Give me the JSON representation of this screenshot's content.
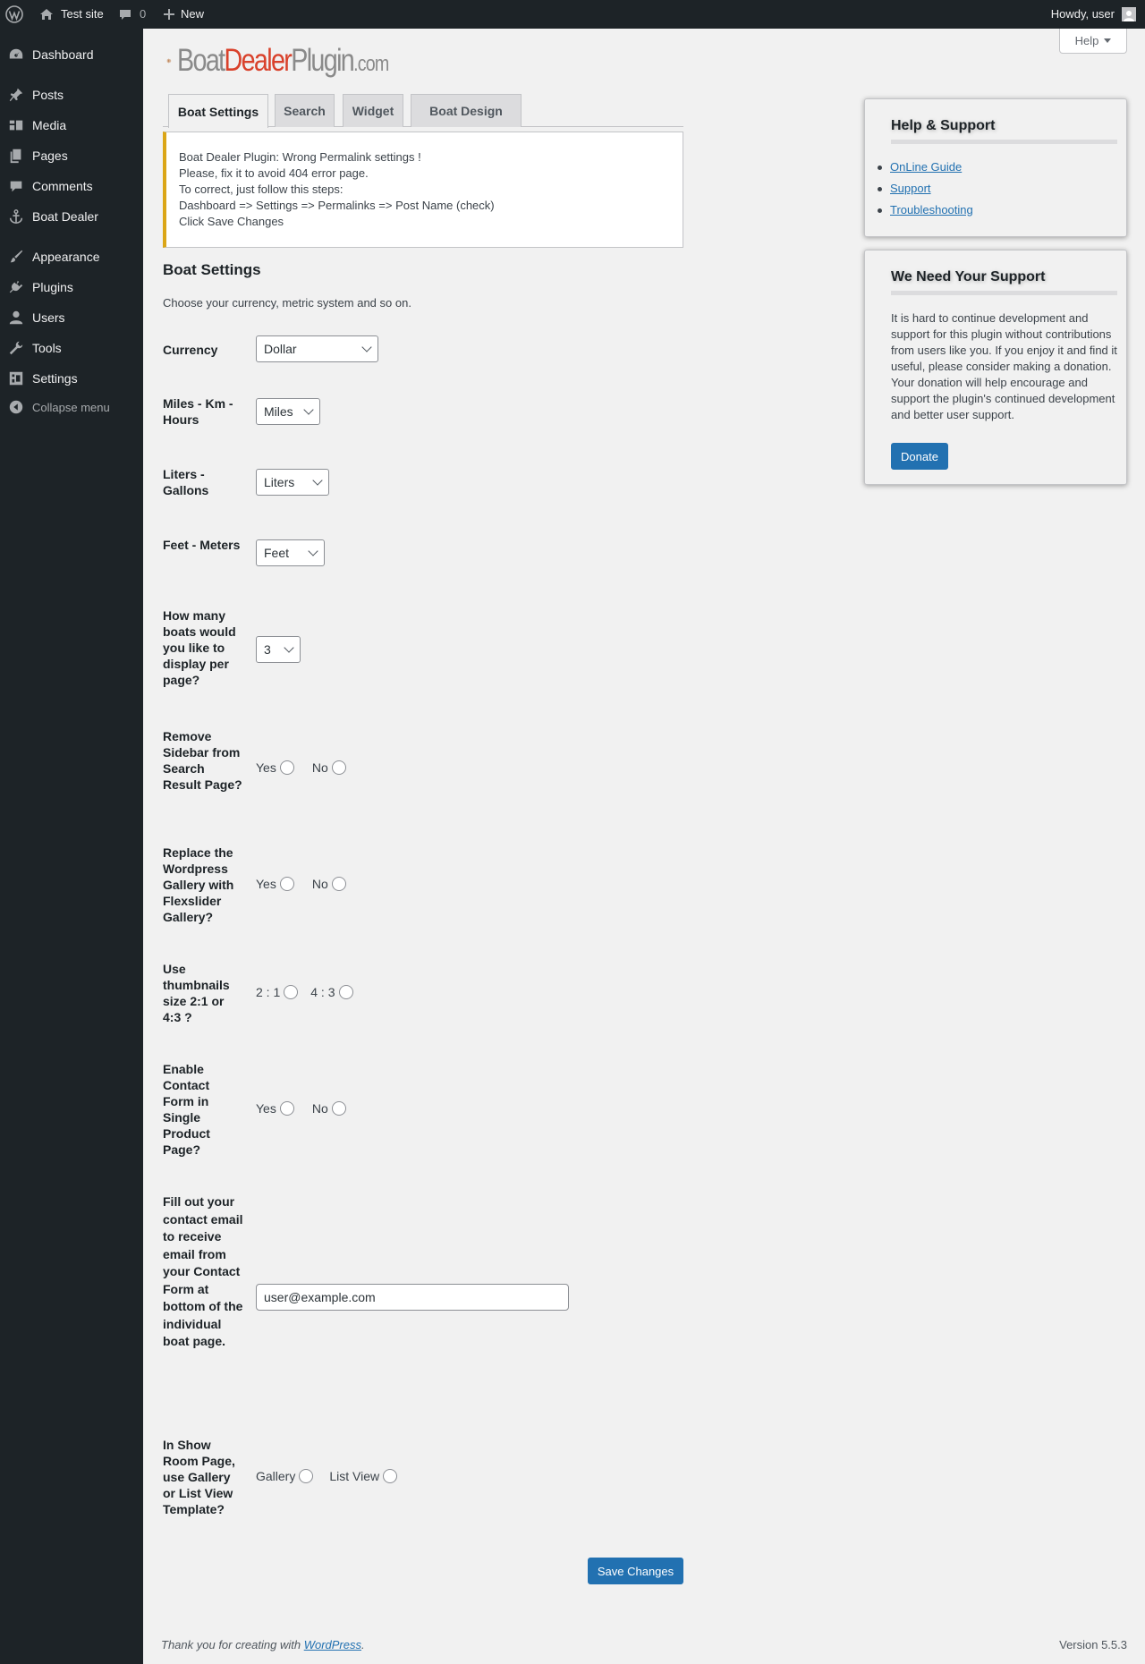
{
  "adminbar": {
    "site_name": "Test site",
    "comments_count": "0",
    "new_label": "New",
    "howdy": "Howdy, user"
  },
  "sidebar": {
    "items": [
      {
        "label": "Dashboard",
        "icon": "dashboard-icon"
      },
      {
        "label": "Posts",
        "icon": "pin-icon"
      },
      {
        "label": "Media",
        "icon": "media-icon"
      },
      {
        "label": "Pages",
        "icon": "pages-icon"
      },
      {
        "label": "Comments",
        "icon": "comment-icon"
      },
      {
        "label": "Boat Dealer",
        "icon": "anchor-icon"
      },
      {
        "label": "Appearance",
        "icon": "brush-icon"
      },
      {
        "label": "Plugins",
        "icon": "plugin-icon"
      },
      {
        "label": "Users",
        "icon": "user-icon"
      },
      {
        "label": "Tools",
        "icon": "wrench-icon"
      },
      {
        "label": "Settings",
        "icon": "settings-icon"
      }
    ],
    "collapse_label": "Collapse menu"
  },
  "help_tab": {
    "label": "Help"
  },
  "logo": {
    "part1": "Boat",
    "part2": "Dealer",
    "part3": "Plugin",
    "part4": ".com"
  },
  "tabs": [
    {
      "label": "Boat Settings",
      "active": true
    },
    {
      "label": "Search"
    },
    {
      "label": "Widget"
    },
    {
      "label": "Boat Design"
    }
  ],
  "notice": {
    "lines": [
      "Boat Dealer Plugin: Wrong Permalink settings !",
      "Please, fix it to avoid 404 error page.",
      "To correct, just follow this steps:",
      "Dashboard => Settings => Permalinks => Post Name (check)",
      "Click Save Changes"
    ],
    "accent_color": "#dba617"
  },
  "settings": {
    "title": "Boat Settings",
    "description": "Choose your currency, metric system and so on.",
    "currency": {
      "label": "Currency",
      "value": "Dollar"
    },
    "distance": {
      "label": "Miles - Km - Hours",
      "value": "Miles"
    },
    "volume": {
      "label": "Liters - Gallons",
      "value": "Liters"
    },
    "length": {
      "label": "Feet - Meters",
      "value": "Feet"
    },
    "per_page": {
      "label": "How many boats would you like to display per page?",
      "value": "3"
    },
    "remove_sidebar": {
      "label": "Remove Sidebar from Search Result Page?",
      "opt1": "Yes",
      "opt2": "No"
    },
    "replace_gallery": {
      "label": "Replace the Wordpress Gallery with Flexslider Gallery?",
      "opt1": "Yes",
      "opt2": "No"
    },
    "thumbnails": {
      "label": "Use thumbnails size 2:1 or 4:3 ?",
      "opt1": "2 : 1",
      "opt2": "4 : 3"
    },
    "contact_form": {
      "label": "Enable Contact Form in Single Product Page?",
      "opt1": "Yes",
      "opt2": "No"
    },
    "contact_email": {
      "label": "Fill out your contact email to receive email from your Contact Form at bottom of the individual boat page.",
      "value": "user@example.com"
    },
    "showroom": {
      "label": "In Show Room Page, use Gallery or List View Template?",
      "opt1": "Gallery",
      "opt2": "List View"
    },
    "save_label": "Save Changes"
  },
  "help_panel": {
    "title": "Help & Support",
    "links": [
      "OnLine Guide",
      "Support",
      "Troubleshooting"
    ]
  },
  "support_panel": {
    "title": "We Need Your Support",
    "text": "It is hard to continue development and support for this plugin without contributions from users like you. If you enjoy it and find it useful, please consider making a donation. Your donation will help encourage and support the plugin's continued development and better user support.",
    "donate_label": "Donate"
  },
  "footer": {
    "thanks_prefix": "Thank you for creating with ",
    "thanks_link": "WordPress",
    "thanks_suffix": ".",
    "version": "Version 5.5.3"
  },
  "colors": {
    "admin_dark": "#1d2327",
    "primary": "#2271b1",
    "brand_red": "#d9412b"
  }
}
